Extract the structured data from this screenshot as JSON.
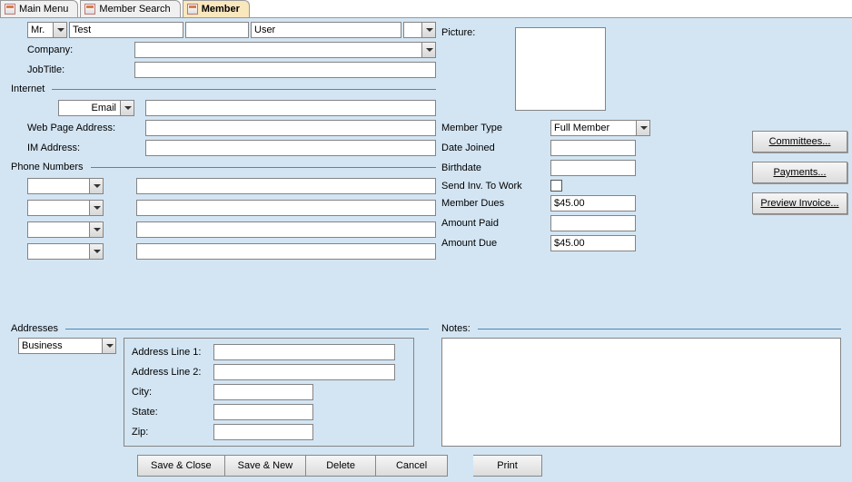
{
  "tabs": {
    "main": "Main Menu",
    "search": "Member Search",
    "member": "Member"
  },
  "name": {
    "title": "Mr.",
    "first": "Test",
    "middle": "",
    "last": "User",
    "suffix": ""
  },
  "companyLabel": "Company:",
  "jobTitleLabel": "JobTitle:",
  "company": "",
  "jobTitle": "",
  "pictureLabel": "Picture:",
  "internet": {
    "section": "Internet",
    "emailType": "Email",
    "email": "",
    "webLabel": "Web Page Address:",
    "web": "",
    "imLabel": "IM Address:",
    "im": ""
  },
  "phones": {
    "section": "Phone Numbers",
    "types": [
      "",
      "",
      "",
      ""
    ],
    "numbers": [
      "",
      "",
      "",
      ""
    ]
  },
  "addresses": {
    "section": "Addresses",
    "type": "Business",
    "line1Label": "Address Line 1:",
    "line2Label": "Address Line 2:",
    "cityLabel": "City:",
    "stateLabel": "State:",
    "zipLabel": "Zip:",
    "line1": "",
    "line2": "",
    "city": "",
    "state": "",
    "zip": ""
  },
  "memberInfo": {
    "typeLabel": "Member Type",
    "type": "Full Member",
    "joinedLabel": "Date Joined",
    "joined": "",
    "birthLabel": "Birthdate",
    "birth": "",
    "sendLabel": "Send Inv. To Work",
    "duesLabel": "Member Dues",
    "dues": "$45.00",
    "paidLabel": "Amount Paid",
    "paid": "",
    "dueLabel": "Amount Due",
    "due": "$45.00"
  },
  "notesLabel": "Notes:",
  "buttons": {
    "committees": "Committees...",
    "payments": "Payments...",
    "preview": "Preview Invoice...",
    "saveClose": "Save & Close",
    "saveNew": "Save & New",
    "delete": "Delete",
    "cancel": "Cancel",
    "print": "Print"
  }
}
